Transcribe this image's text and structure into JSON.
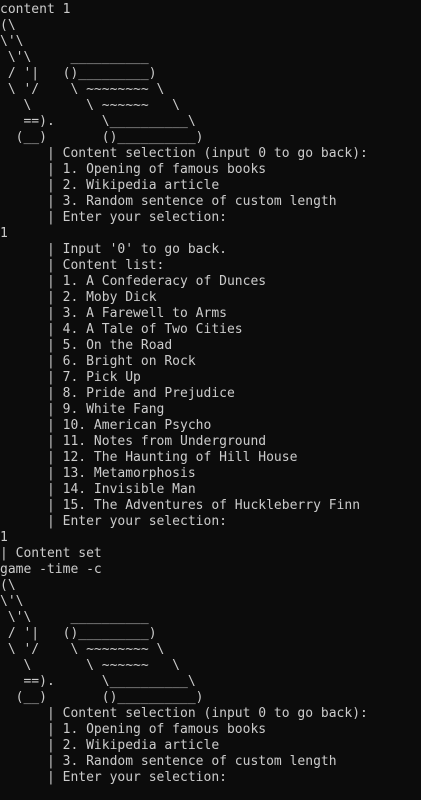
{
  "lines": [
    "content 1",
    "(\\",
    "\\'\\",
    " \\'\\     __________",
    " / '|   ()_________)",
    " \\ '/    \\ ~~~~~~~~ \\",
    "   \\       \\ ~~~~~~   \\",
    "   ==).      \\__________\\",
    "  (__)       ()__________)",
    "      | Content selection (input 0 to go back):",
    "      | 1. Opening of famous books",
    "      | 2. Wikipedia article",
    "      | 3. Random sentence of custom length",
    "      | Enter your selection:",
    "1",
    "      | Input '0' to go back.",
    "      | Content list:",
    "      | 1. A Confederacy of Dunces",
    "      | 2. Moby Dick",
    "      | 3. A Farewell to Arms",
    "      | 4. A Tale of Two Cities",
    "      | 5. On the Road",
    "      | 6. Bright on Rock",
    "      | 7. Pick Up",
    "      | 8. Pride and Prejudice",
    "      | 9. White Fang",
    "      | 10. American Psycho",
    "      | 11. Notes from Underground",
    "      | 12. The Haunting of Hill House",
    "      | 13. Metamorphosis",
    "      | 14. Invisible Man",
    "      | 15. The Adventures of Huckleberry Finn",
    "      | Enter your selection:",
    "1",
    "| Content set",
    "game -time -c",
    "(\\",
    "\\'\\",
    " \\'\\     __________",
    " / '|   ()_________)",
    " \\ '/    \\ ~~~~~~~~ \\",
    "   \\       \\ ~~~~~~   \\",
    "   ==).      \\__________\\",
    "  (__)       ()__________)",
    "      | Content selection (input 0 to go back):",
    "      | 1. Opening of famous books",
    "      | 2. Wikipedia article",
    "      | 3. Random sentence of custom length",
    "      | Enter your selection:"
  ]
}
